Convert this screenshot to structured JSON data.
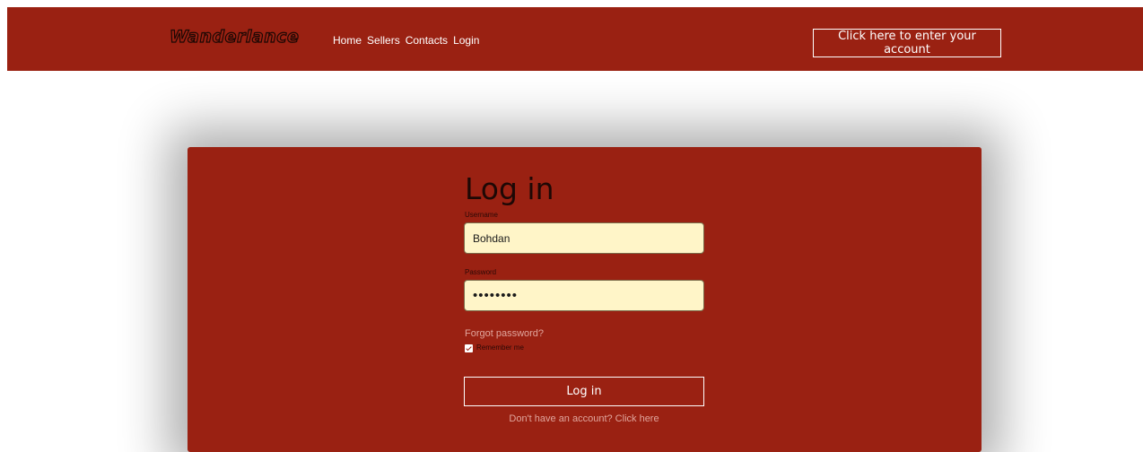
{
  "header": {
    "logo": "Wanderlance",
    "nav": [
      "Home",
      "Sellers",
      "Contacts",
      "Login"
    ],
    "account_button": "Click here to enter your account"
  },
  "login": {
    "title": "Log in",
    "username_label": "Username",
    "username_value": "Bohdan",
    "password_label": "Password",
    "password_value": "••••••••",
    "forgot": "Forgot password?",
    "remember": "Remember me",
    "remember_checked": true,
    "submit": "Log in",
    "signup": "Don't have an account? Click here"
  },
  "colors": {
    "primary": "#9a2112",
    "input_bg": "#fff5c8",
    "link": "#e0a59c"
  }
}
